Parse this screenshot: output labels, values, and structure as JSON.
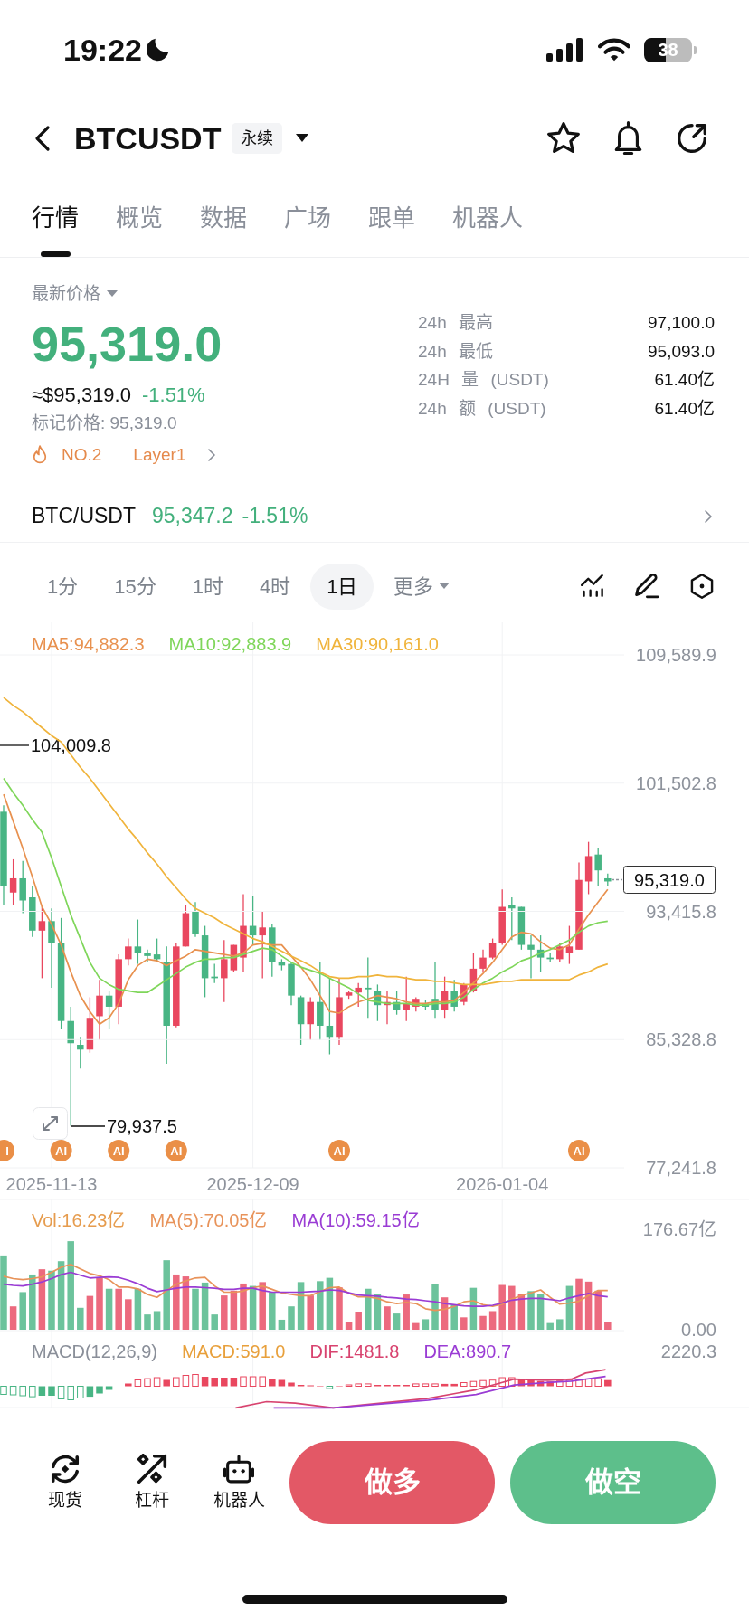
{
  "status_bar": {
    "time": "19:22",
    "battery": "38"
  },
  "header": {
    "title": "BTCUSDT",
    "contract_tag": "永续"
  },
  "tabs": [
    {
      "label": "行情",
      "selected": true
    },
    {
      "label": "概览",
      "selected": false
    },
    {
      "label": "数据",
      "selected": false
    },
    {
      "label": "广场",
      "selected": false
    },
    {
      "label": "跟单",
      "selected": false
    },
    {
      "label": "机器人",
      "selected": false
    }
  ],
  "price_panel": {
    "label": "最新价格",
    "last_price": "95,319.0",
    "usd_value": "≈$95,319.0",
    "change": "-1.51%",
    "mark_price": "标记价格: 95,319.0",
    "rank": "NO.2",
    "sector": "Layer1"
  },
  "stats": [
    {
      "label": "24h 最高",
      "value": "97,100.0"
    },
    {
      "label": "24h 最低",
      "value": "95,093.0"
    },
    {
      "label": "24H 量 (USDT)",
      "value": "61.40亿"
    },
    {
      "label": "24h 额 (USDT)",
      "value": "61.40亿"
    }
  ],
  "spot_row": {
    "pair": "BTC/USDT",
    "price": "95,347.2",
    "change": "-1.51%"
  },
  "timeframes": [
    {
      "label": "1分",
      "kind": "option",
      "selected": false
    },
    {
      "label": "15分",
      "kind": "option",
      "selected": false
    },
    {
      "label": "1时",
      "kind": "option",
      "selected": false
    },
    {
      "label": "4时",
      "kind": "option",
      "selected": false
    },
    {
      "label": "1日",
      "kind": "option",
      "selected": true
    },
    {
      "label": "更多",
      "kind": "menu",
      "selected": false
    }
  ],
  "chart": {
    "chart_data": {
      "type": "candlestick",
      "categories": [
        null,
        null,
        null,
        null,
        null,
        "2025-11-13",
        null,
        null,
        null,
        null,
        null,
        null,
        null,
        null,
        null,
        null,
        null,
        null,
        null,
        null,
        null,
        null,
        null,
        null,
        null,
        null,
        "2025-12-09",
        null,
        null,
        null,
        null,
        null,
        null,
        null,
        null,
        null,
        null,
        null,
        null,
        null,
        null,
        null,
        null,
        null,
        null,
        null,
        null,
        null,
        null,
        null,
        null,
        null,
        "2026-01-04",
        null,
        null,
        null,
        null,
        null,
        null,
        null,
        null,
        null,
        null,
        null
      ],
      "ylim": [
        77241.8,
        109589.9
      ],
      "grid": true,
      "ohlc": [
        [
          99700,
          100100,
          93800,
          95000
        ],
        [
          94600,
          96700,
          93800,
          95500
        ],
        [
          95500,
          96600,
          93300,
          94100
        ],
        [
          94300,
          95000,
          91800,
          92200
        ],
        [
          92200,
          93700,
          89200,
          92800
        ],
        [
          92800,
          93600,
          88600,
          91400
        ],
        [
          91400,
          93000,
          86000,
          86500
        ],
        [
          86500,
          87400,
          79900,
          85100
        ],
        [
          85000,
          85500,
          83500,
          84700
        ],
        [
          84700,
          88000,
          84500,
          86700
        ],
        [
          86800,
          89100,
          85300,
          88100
        ],
        [
          88100,
          88400,
          86000,
          87400
        ],
        [
          87400,
          90700,
          86300,
          90400
        ],
        [
          90400,
          91700,
          90000,
          91200
        ],
        [
          91200,
          92900,
          90100,
          90800
        ],
        [
          90800,
          91000,
          90200,
          90600
        ],
        [
          90700,
          91700,
          90200,
          90400
        ],
        [
          90200,
          91200,
          83800,
          86200
        ],
        [
          86200,
          91400,
          86100,
          91200
        ],
        [
          91200,
          93800,
          91200,
          93300
        ],
        [
          93400,
          94000,
          91800,
          92000
        ],
        [
          91900,
          92500,
          88000,
          89200
        ],
        [
          89300,
          90100,
          88900,
          89200
        ],
        [
          89200,
          91600,
          87700,
          90400
        ],
        [
          89700,
          91300,
          89600,
          91300
        ],
        [
          90500,
          94500,
          89600,
          92500
        ],
        [
          92500,
          94400,
          91300,
          91900
        ],
        [
          91900,
          93400,
          89200,
          92400
        ],
        [
          92400,
          92600,
          89300,
          90200
        ],
        [
          90200,
          90400,
          89700,
          90000
        ],
        [
          90100,
          90200,
          87500,
          88100
        ],
        [
          88000,
          88100,
          85000,
          86300
        ],
        [
          86300,
          88000,
          85300,
          87700
        ],
        [
          87700,
          90200,
          85300,
          86200
        ],
        [
          86200,
          89200,
          84400,
          85500
        ],
        [
          85500,
          89200,
          85000,
          88000
        ],
        [
          88100,
          88400,
          87900,
          88300
        ],
        [
          88300,
          88900,
          87400,
          88600
        ],
        [
          88600,
          90500,
          86700,
          88500
        ],
        [
          88400,
          88800,
          86500,
          87500
        ],
        [
          87500,
          88400,
          86300,
          87700
        ],
        [
          87700,
          88400,
          86900,
          87200
        ],
        [
          87200,
          89300,
          86500,
          87600
        ],
        [
          87400,
          88000,
          87100,
          87900
        ],
        [
          87600,
          87800,
          87200,
          87400
        ],
        [
          87900,
          90200,
          86700,
          87200
        ],
        [
          87200,
          89300,
          86700,
          88400
        ],
        [
          88400,
          89100,
          87100,
          87400
        ],
        [
          87700,
          88900,
          87500,
          88800
        ],
        [
          88400,
          90800,
          88300,
          89800
        ],
        [
          89800,
          91000,
          89600,
          90500
        ],
        [
          90500,
          91700,
          90400,
          91400
        ],
        [
          91400,
          94800,
          91300,
          93700
        ],
        [
          93800,
          94300,
          91600,
          93600
        ],
        [
          93700,
          93700,
          91000,
          91300
        ],
        [
          91300,
          91900,
          89200,
          91000
        ],
        [
          91000,
          91900,
          89600,
          90500
        ],
        [
          90500,
          90800,
          90200,
          90400
        ],
        [
          90400,
          91400,
          90200,
          91200
        ],
        [
          90800,
          92500,
          90100,
          91200
        ],
        [
          91000,
          96500,
          91000,
          95400
        ],
        [
          95300,
          97800,
          94500,
          96900
        ],
        [
          97000,
          97400,
          95000,
          96000
        ],
        [
          95500,
          95800,
          95000,
          95300
        ]
      ]
    },
    "moving_averages": {
      "chart_data": {
        "type": "line",
        "categories": [
          null,
          null,
          null,
          null,
          null,
          null,
          null,
          null,
          null,
          null,
          null,
          null,
          null,
          null,
          null,
          null,
          null,
          null,
          null,
          null,
          null,
          null,
          null,
          null,
          null,
          null,
          null,
          null,
          null,
          null,
          null,
          null,
          null,
          null,
          null,
          null,
          null,
          null,
          null,
          null,
          null,
          null,
          null,
          null,
          null,
          null,
          null,
          null,
          null,
          null,
          null,
          null,
          null,
          null,
          null,
          null,
          null,
          null,
          null,
          null,
          null,
          null,
          null,
          null
        ],
        "ylim": [
          77241.8,
          109589.9
        ],
        "yticks": [
          {
            "value": 109589.9,
            "label": "109,589.9"
          },
          {
            "value": 101502.8,
            "label": "101,502.8"
          },
          {
            "value": 93415.8,
            "label": "93,415.8"
          },
          {
            "value": 85328.8,
            "label": "85,328.8"
          },
          {
            "value": 77241.8,
            "label": "77,241.8"
          }
        ],
        "grid": true,
        "series": [
          {
            "name": "MA5:94,882.3",
            "color": "#e8914f",
            "values": [
              100800,
              99100,
              97400,
              95600,
              93700,
              92600,
              91300,
              89600,
              88100,
              87100,
              86300,
              86700,
              87600,
              89100,
              90000,
              90400,
              90300,
              90000,
              90300,
              90600,
              91000,
              90900,
              90800,
              90700,
              90600,
              90800,
              91300,
              91400,
              91300,
              91300,
              90600,
              89900,
              89100,
              88100,
              87100,
              87000,
              87400,
              87700,
              87900,
              88100,
              88000,
              87900,
              87700,
              87600,
              87600,
              87700,
              87700,
              87800,
              88300,
              88900,
              89500,
              90200,
              91000,
              91800,
              92100,
              92000,
              91500,
              91100,
              91000,
              91300,
              92300,
              93200,
              94000,
              94800
            ]
          },
          {
            "name": "MA10:92,883.9",
            "color": "#7fd65a",
            "values": [
              101800,
              100900,
              100100,
              99200,
              98400,
              96800,
              95000,
              93200,
              91700,
              90200,
              89200,
              88800,
              88500,
              88400,
              88300,
              88300,
              88700,
              89100,
              89500,
              89900,
              90200,
              90400,
              90400,
              90500,
              90500,
              90700,
              90900,
              91100,
              91000,
              90600,
              90200,
              89900,
              89700,
              89500,
              89200,
              88900,
              88600,
              88200,
              87800,
              87700,
              87600,
              87600,
              87600,
              87500,
              87500,
              87600,
              87600,
              87700,
              88000,
              88500,
              88900,
              89200,
              89600,
              89900,
              90300,
              90500,
              90800,
              91000,
              91300,
              91600,
              92100,
              92500,
              92700,
              92800
            ]
          },
          {
            "name": "MA30:90,161.0",
            "color": "#f0b43c",
            "values": [
              106900,
              106400,
              106000,
              105500,
              105000,
              104500,
              104100,
              103300,
              102500,
              101800,
              101000,
              100200,
              99400,
              98600,
              97900,
              97100,
              96400,
              95600,
              94900,
              94200,
              93600,
              93300,
              93000,
              92600,
              92300,
              92000,
              91700,
              91500,
              91200,
              90900,
              90600,
              90300,
              90000,
              89600,
              89300,
              89200,
              89200,
              89300,
              89300,
              89400,
              89300,
              89300,
              89200,
              89100,
              89100,
              89000,
              89000,
              88900,
              88800,
              88800,
              88800,
              88900,
              89000,
              89000,
              89100,
              89100,
              89100,
              89100,
              89100,
              89100,
              89400,
              89600,
              89900,
              90100
            ]
          }
        ]
      }
    },
    "high_label": "104,009.8",
    "low_label": "79,937.5",
    "price_tag": "95,319.0",
    "ai_markers": [
      "I",
      "AI",
      "AI",
      "AI",
      "AI",
      "AI"
    ]
  },
  "volume": {
    "legend": [
      {
        "label": "Vol:16.23亿",
        "color": "#e69c4e"
      }
    ],
    "averages": {
      "chart_data": {
        "type": "line",
        "categories": [
          null,
          null,
          null,
          null,
          null,
          null,
          null,
          null,
          null,
          null,
          null,
          null,
          null,
          null,
          null,
          null,
          null,
          null,
          null,
          null,
          null,
          null,
          null,
          null,
          null,
          null,
          null,
          null,
          null,
          null,
          null,
          null,
          null,
          null,
          null,
          null,
          null,
          null,
          null,
          null,
          null,
          null,
          null,
          null,
          null,
          null,
          null,
          null,
          null,
          null,
          null,
          null,
          null,
          null,
          null,
          null,
          null,
          null,
          null,
          null,
          null,
          null,
          null,
          null
        ],
        "ylim": [
          0,
          176.67
        ],
        "yticks": [
          {
            "value": 176.67,
            "label": "176.67亿"
          },
          {
            "value": 0,
            "label": "0.00"
          }
        ],
        "series": [
          {
            "name": "MA(5):70.05亿",
            "color": "#e8935a",
            "values": [
              94,
              90,
              88,
              90,
              93,
              101,
              110,
              115,
              107,
              99,
              95,
              88,
              75,
              75,
              72,
              62,
              57,
              69,
              80,
              86,
              91,
              92,
              77,
              66,
              66,
              68,
              74,
              77,
              71,
              65,
              62,
              60,
              60,
              67,
              74,
              75,
              64,
              58,
              58,
              55,
              49,
              46,
              48,
              46,
              37,
              34,
              36,
              41,
              49,
              51,
              44,
              41,
              45,
              54,
              60,
              65,
              70,
              57,
              45,
              47,
              50,
              60,
              69,
              69
            ]
          },
          {
            "name": "MA(10):59.15亿",
            "color": "#9a3cd4",
            "values": [
              80,
              78,
              77,
              80,
              84,
              90,
              97,
              101,
              96,
              91,
              92,
              93,
              92,
              87,
              81,
              73,
              67,
              70,
              73,
              75,
              75,
              74,
              73,
              71,
              71,
              73,
              73,
              69,
              66,
              66,
              66,
              66,
              67,
              68,
              70,
              69,
              65,
              61,
              60,
              59,
              57,
              56,
              54,
              53,
              51,
              49,
              46,
              44,
              42,
              41,
              41,
              43,
              47,
              52,
              54,
              55,
              55,
              53,
              51,
              56,
              60,
              64,
              60,
              58
            ]
          }
        ]
      }
    }
  },
  "macd": {
    "legend": [
      {
        "label": "MACD(12,26,9)",
        "color": "#8a8f99"
      },
      {
        "label": "MACD:591.0",
        "color": "#e8a03c"
      },
      {
        "label": "DIF:1481.8",
        "color": "#d8436f"
      },
      {
        "label": "DEA:890.7",
        "color": "#9a3cd4"
      }
    ],
    "y_label": "2220.3"
  },
  "bottom_nav": [
    {
      "label": "现货",
      "kind": "spot"
    },
    {
      "label": "杠杆",
      "kind": "margin"
    },
    {
      "label": "机器人",
      "kind": "bot"
    }
  ],
  "actions": [
    {
      "label": "做多",
      "kind": "long"
    },
    {
      "label": "做空",
      "kind": "short"
    }
  ]
}
